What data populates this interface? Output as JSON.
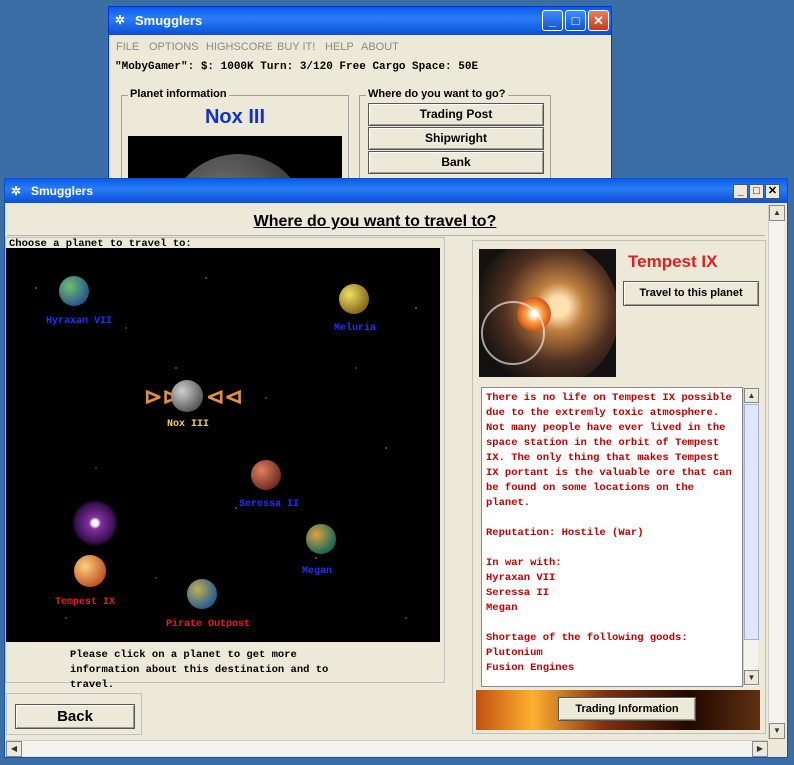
{
  "back_window": {
    "title": "Smugglers",
    "menu": [
      "FILE",
      "OPTIONS",
      "HIGHSCORE",
      "BUY IT!",
      "HELP",
      "ABOUT"
    ],
    "status": "\"MobyGamer\": $: 1000K Turn: 3/120 Free Cargo Space: 50E",
    "planet_info_label": "Planet information",
    "planet_name": "Nox III",
    "where_label": "Where do you want to go?",
    "buttons": [
      "Trading Post",
      "Shipwright",
      "Bank"
    ]
  },
  "main_window": {
    "title": "Smugglers",
    "heading": "Where do you want to travel to?",
    "choose_label": "Choose a planet to travel to:",
    "hint": "Please  click on a planet to get more information about this destination and to travel.",
    "back_button": "Back",
    "selected_planet": "Tempest IX",
    "travel_button": "Travel to this planet",
    "trading_button": "Trading Information",
    "description": [
      "There is no life on Tempest IX possible due to the extremly toxic atmosphere. Not many people have ever lived in the space station in the orbit of Tempest IX. The only thing that makes Tempest IX portant is the valuable ore that can be found on some locations on the planet.",
      "Reputation: Hostile (War)",
      "In war with:",
      "Hyraxan VII",
      "Seressa II",
      "Megan",
      "Shortage of the following goods:",
      "Plutonium",
      "Fusion Engines"
    ]
  },
  "planets": [
    {
      "name": "Hyraxan VII",
      "label_color": "#2030ff",
      "color": "#3d8a4a"
    },
    {
      "name": "Meluria",
      "label_color": "#2030ff",
      "color": "#c8a030"
    },
    {
      "name": "Nox III",
      "label_color": "#f0d060",
      "color": "#a0a0a0"
    },
    {
      "name": "Seressa II",
      "label_color": "#2030ff",
      "color": "#c06040"
    },
    {
      "name": "Megan",
      "label_color": "#2030ff",
      "color": "#408060"
    },
    {
      "name": "Tempest IX",
      "label_color": "#e02020",
      "color": "#e09050"
    },
    {
      "name": "Pirate Outpost",
      "label_color": "#e02020",
      "color": "#3070a0"
    }
  ],
  "colors": {
    "accent_red": "#c00000",
    "title_blue": "#0a4fd6",
    "planet_name_blue": "#1030d0"
  }
}
